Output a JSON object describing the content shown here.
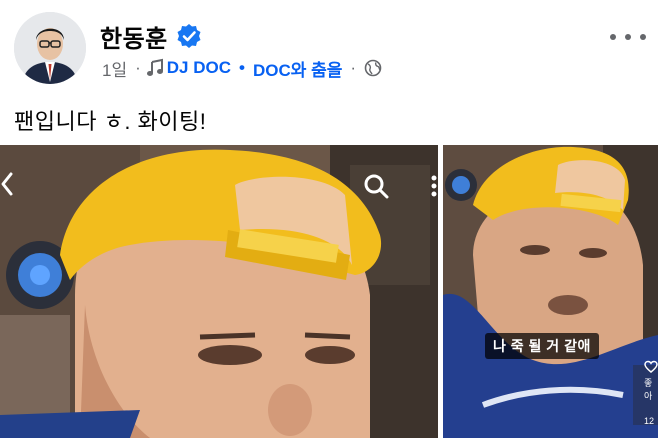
{
  "post": {
    "author": "한동훈",
    "time": "1일",
    "song": "DJ DOC",
    "song_title": "DOC와 춤을",
    "text": "팬입니다 ㅎ. 화이팅!"
  },
  "icons": {
    "verified": "verified-badge-icon",
    "music": "music-note-icon",
    "privacy": "globe-icon",
    "more": "more-options-icon",
    "back": "chevron-left-icon",
    "search": "search-icon",
    "menu": "kebab-icon",
    "like": "heart-icon"
  },
  "media": {
    "caption": "나 죽 될 거 같애",
    "side_label": "좋아",
    "side_count": "12"
  },
  "colors": {
    "accent": "#0861f2",
    "verified": "#1877f2",
    "meta": "#65676b",
    "text": "#050505",
    "cap": "#f2bd1d"
  }
}
